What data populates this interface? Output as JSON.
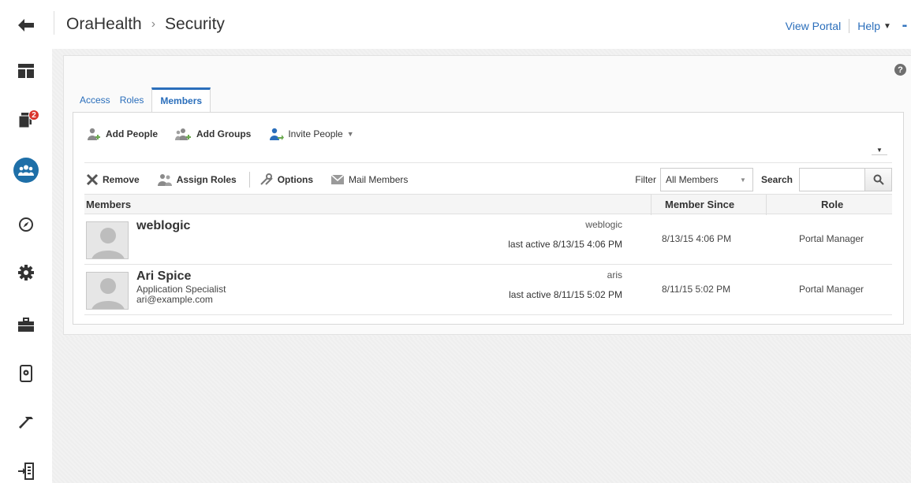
{
  "header": {
    "breadcrumb_root": "OraHealth",
    "breadcrumb_sep": "›",
    "breadcrumb_current": "Security",
    "view_portal": "View Portal",
    "help": "Help",
    "more": "▪▪"
  },
  "nav": {
    "notification_count": "2"
  },
  "help_icon": "?",
  "tabs": [
    {
      "label": "Access"
    },
    {
      "label": "Roles"
    },
    {
      "label": "Members"
    }
  ],
  "toolbar1": {
    "add_people": "Add People",
    "add_groups": "Add Groups",
    "invite_people": "Invite People"
  },
  "toolbar2": {
    "remove": "Remove",
    "assign_roles": "Assign Roles",
    "options": "Options",
    "mail_members": "Mail Members",
    "filter_label": "Filter",
    "filter_value": "All Members",
    "search_label": "Search"
  },
  "table": {
    "columns": [
      "Members",
      "Member Since",
      "Role"
    ],
    "rows": [
      {
        "name": "weblogic",
        "title": "",
        "email": "",
        "username": "weblogic",
        "last_active": "last active 8/13/15 4:06 PM",
        "member_since": "8/13/15 4:06 PM",
        "role": "Portal Manager"
      },
      {
        "name": "Ari Spice",
        "title": "Application Specialist",
        "email": "ari@example.com",
        "username": "aris",
        "last_active": "last active 8/11/15 5:02 PM",
        "member_since": "8/11/15 5:02 PM",
        "role": "Portal Manager"
      }
    ]
  },
  "colors": {
    "accent": "#2a6ebb",
    "nav_active": "#1e6fa8",
    "badge": "#d9352c"
  },
  "icons": {
    "nav": [
      "back-arrow-icon",
      "layout-icon",
      "pages-icon",
      "members-icon",
      "compass-icon",
      "gear-icon",
      "toolbox-icon",
      "device-settings-icon",
      "hammer-icon",
      "exit-icon"
    ]
  }
}
